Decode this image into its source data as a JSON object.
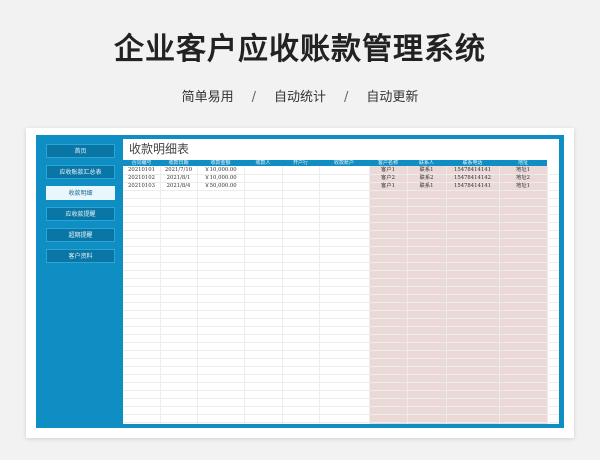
{
  "header": {
    "title": "企业客户应收账款管理系统",
    "features": [
      "简单易用",
      "自动统计",
      "自动更新"
    ],
    "separator": "/"
  },
  "sidebar": {
    "items": [
      {
        "label": "首页",
        "active": false
      },
      {
        "label": "应收账款汇总表",
        "active": false
      },
      {
        "label": "收款明细",
        "active": true
      },
      {
        "label": "应收款提醒",
        "active": false
      },
      {
        "label": "超期提醒",
        "active": false
      },
      {
        "label": "客户资料",
        "active": false
      }
    ]
  },
  "main": {
    "title": "收款明细表",
    "table": {
      "columns": [
        "合同编号",
        "收款日期",
        "收款金额",
        "收款人",
        "开户行",
        "收款账户",
        "客户名称",
        "联系人",
        "联系电话",
        "地址"
      ],
      "rows": [
        [
          "20210101",
          "2021/7/10",
          "￥10,000.00",
          "",
          "",
          "",
          "客户1",
          "联系1",
          "15478414141",
          "地址1"
        ],
        [
          "20210102",
          "2021/8/1",
          "￥10,000.00",
          "",
          "",
          "",
          "客户2",
          "联系2",
          "15478414142",
          "地址2"
        ],
        [
          "20210103",
          "2021/8/4",
          "￥50,000.00",
          "",
          "",
          "",
          "客户1",
          "联系1",
          "15478414141",
          "地址1"
        ]
      ],
      "shaded_columns_from": 6,
      "colors": {
        "header": "#0f8ec4",
        "shade": "#ead9d6"
      }
    }
  }
}
